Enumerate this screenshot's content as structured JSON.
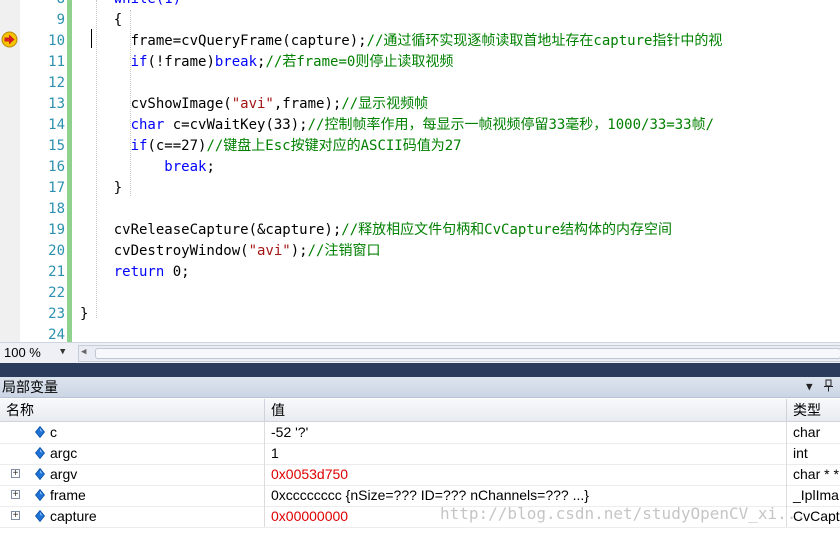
{
  "editor": {
    "lines": [
      {
        "n": "8",
        "segs": [
          {
            "t": "    while(1)",
            "c": "kw"
          }
        ]
      },
      {
        "n": "9",
        "segs": [
          {
            "t": "    {",
            "c": ""
          }
        ]
      },
      {
        "n": "10",
        "segs": [
          {
            "t": "      frame=cvQueryFrame(capture);",
            "c": ""
          },
          {
            "t": "//通过循环实现逐帧读取首地址存在capture指针中的视",
            "c": "cm"
          }
        ]
      },
      {
        "n": "11",
        "segs": [
          {
            "t": "      ",
            "c": ""
          },
          {
            "t": "if",
            "c": "kw"
          },
          {
            "t": "(!frame)",
            "c": ""
          },
          {
            "t": "break",
            "c": "kw"
          },
          {
            "t": ";",
            "c": ""
          },
          {
            "t": "//若frame=0则停止读取视频",
            "c": "cm"
          }
        ]
      },
      {
        "n": "12",
        "segs": [
          {
            "t": "",
            "c": ""
          }
        ]
      },
      {
        "n": "13",
        "segs": [
          {
            "t": "      cvShowImage(",
            "c": ""
          },
          {
            "t": "\"avi\"",
            "c": "st"
          },
          {
            "t": ",frame);",
            "c": ""
          },
          {
            "t": "//显示视频帧",
            "c": "cm"
          }
        ]
      },
      {
        "n": "14",
        "segs": [
          {
            "t": "      ",
            "c": ""
          },
          {
            "t": "char",
            "c": "kw"
          },
          {
            "t": " c=cvWaitKey(33);",
            "c": ""
          },
          {
            "t": "//控制帧率作用，每显示一帧视频停留33毫秒，1000/33=33帧/",
            "c": "cm"
          }
        ]
      },
      {
        "n": "15",
        "segs": [
          {
            "t": "      ",
            "c": ""
          },
          {
            "t": "if",
            "c": "kw"
          },
          {
            "t": "(c==27)",
            "c": ""
          },
          {
            "t": "//键盘上Esc按键对应的ASCII码值为27",
            "c": "cm"
          }
        ]
      },
      {
        "n": "16",
        "segs": [
          {
            "t": "          ",
            "c": ""
          },
          {
            "t": "break",
            "c": "kw"
          },
          {
            "t": ";",
            "c": ""
          }
        ]
      },
      {
        "n": "17",
        "segs": [
          {
            "t": "    }",
            "c": ""
          }
        ]
      },
      {
        "n": "18",
        "segs": [
          {
            "t": "",
            "c": ""
          }
        ]
      },
      {
        "n": "19",
        "segs": [
          {
            "t": "    cvReleaseCapture(&capture);",
            "c": ""
          },
          {
            "t": "//释放相应文件句柄和CvCapture结构体的内存空间",
            "c": "cm"
          }
        ]
      },
      {
        "n": "20",
        "segs": [
          {
            "t": "    cvDestroyWindow(",
            "c": ""
          },
          {
            "t": "\"avi\"",
            "c": "st"
          },
          {
            "t": ");",
            "c": ""
          },
          {
            "t": "//注销窗口",
            "c": "cm"
          }
        ]
      },
      {
        "n": "21",
        "segs": [
          {
            "t": "    ",
            "c": ""
          },
          {
            "t": "return",
            "c": "kw"
          },
          {
            "t": " 0;",
            "c": ""
          }
        ]
      },
      {
        "n": "22",
        "segs": [
          {
            "t": "",
            "c": ""
          }
        ]
      },
      {
        "n": "23",
        "segs": [
          {
            "t": "}",
            "c": ""
          }
        ]
      },
      {
        "n": "24",
        "segs": [
          {
            "t": "",
            "c": ""
          }
        ]
      }
    ],
    "current_line": "10"
  },
  "statusbar": {
    "zoom": "100 %"
  },
  "locals": {
    "title": "局部变量",
    "columns": {
      "name": "名称",
      "value": "值",
      "type": "类型"
    },
    "rows": [
      {
        "name": "c",
        "value": "-52 '?'",
        "type": "char",
        "red": false,
        "expandable": false
      },
      {
        "name": "argc",
        "value": "1",
        "type": "int",
        "red": false,
        "expandable": false
      },
      {
        "name": "argv",
        "value": "0x0053d750",
        "type": "char * *",
        "red": true,
        "expandable": true
      },
      {
        "name": "frame",
        "value": "0xcccccccc {nSize=??? ID=??? nChannels=??? ...}",
        "type": "_IplIma",
        "red": false,
        "expandable": true
      },
      {
        "name": "capture",
        "value": "0x00000000",
        "type": "CvCapt",
        "red": true,
        "expandable": true
      }
    ]
  },
  "watermark": "http://blog.csdn.net/studyOpenCV_xi...",
  "icons": {
    "breakpoint": "current-statement-arrow-icon",
    "variable": "local-variable-icon",
    "dropdown": "chevron-down-icon",
    "pin": "pin-icon"
  },
  "colors": {
    "keyword": "#0000ff",
    "comment": "#008000",
    "string": "#a31515",
    "error_value": "#e00000",
    "change_bar": "#8ed28e"
  }
}
